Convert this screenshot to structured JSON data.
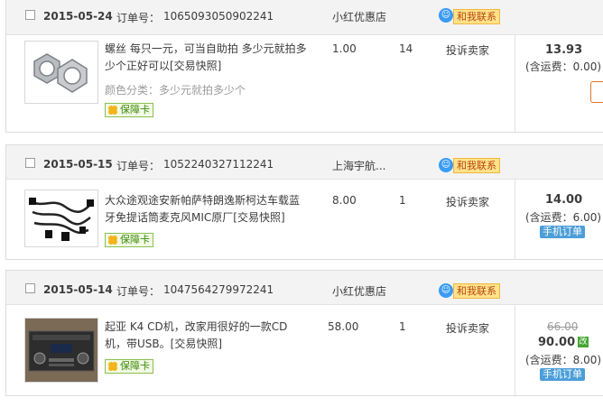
{
  "labels": {
    "order_no": "订单号：",
    "contact": "和我联系",
    "complaint": "投诉卖家",
    "guarantee": "保障卡",
    "mobile_order": "手机订单",
    "changed_price": "改"
  },
  "orders": [
    {
      "date": "2015-05-24",
      "order_number": "1065093050902241",
      "shop": "小红优惠店",
      "item_title": "螺丝 每只一元，可当自助拍 多少元就拍多少个正好可以[交易快照]",
      "sku": "颜色分类：多少元就拍多少个",
      "unit_price": "1.00",
      "quantity": "14",
      "total": "13.93",
      "shipping": "(含运费：0.00)",
      "thumbnail": "hex-nut-icon"
    },
    {
      "date": "2015-05-15",
      "order_number": "1052240327112241",
      "shop": "上海宇航...",
      "item_title": "大众途观途安新帕萨特朗逸斯柯达车载蓝牙免提话筒麦克风MIC原厂[交易快照]",
      "unit_price": "8.00",
      "quantity": "1",
      "total": "14.00",
      "shipping": "(含运费：6.00)",
      "thumbnail": "wire-harness-icon"
    },
    {
      "date": "2015-05-14",
      "order_number": "1047564279972241",
      "shop": "小红优惠店",
      "item_title": "起亚 K4 CD机，改家用很好的一款CD机，带USB。[交易快照]",
      "unit_price": "58.00",
      "quantity": "1",
      "original_total": "66.00",
      "total": "90.00",
      "shipping": "(含运费：8.00)",
      "thumbnail": "car-cd-player-icon"
    }
  ],
  "colors": {
    "contact_bg": "#ffe28a",
    "contact_text": "#b8470f",
    "badge_green": "#3f8a0d",
    "mobile_blue": "#4b9ed8",
    "header_bg": "#f3f3f3",
    "edge_button": "#e0772b"
  }
}
